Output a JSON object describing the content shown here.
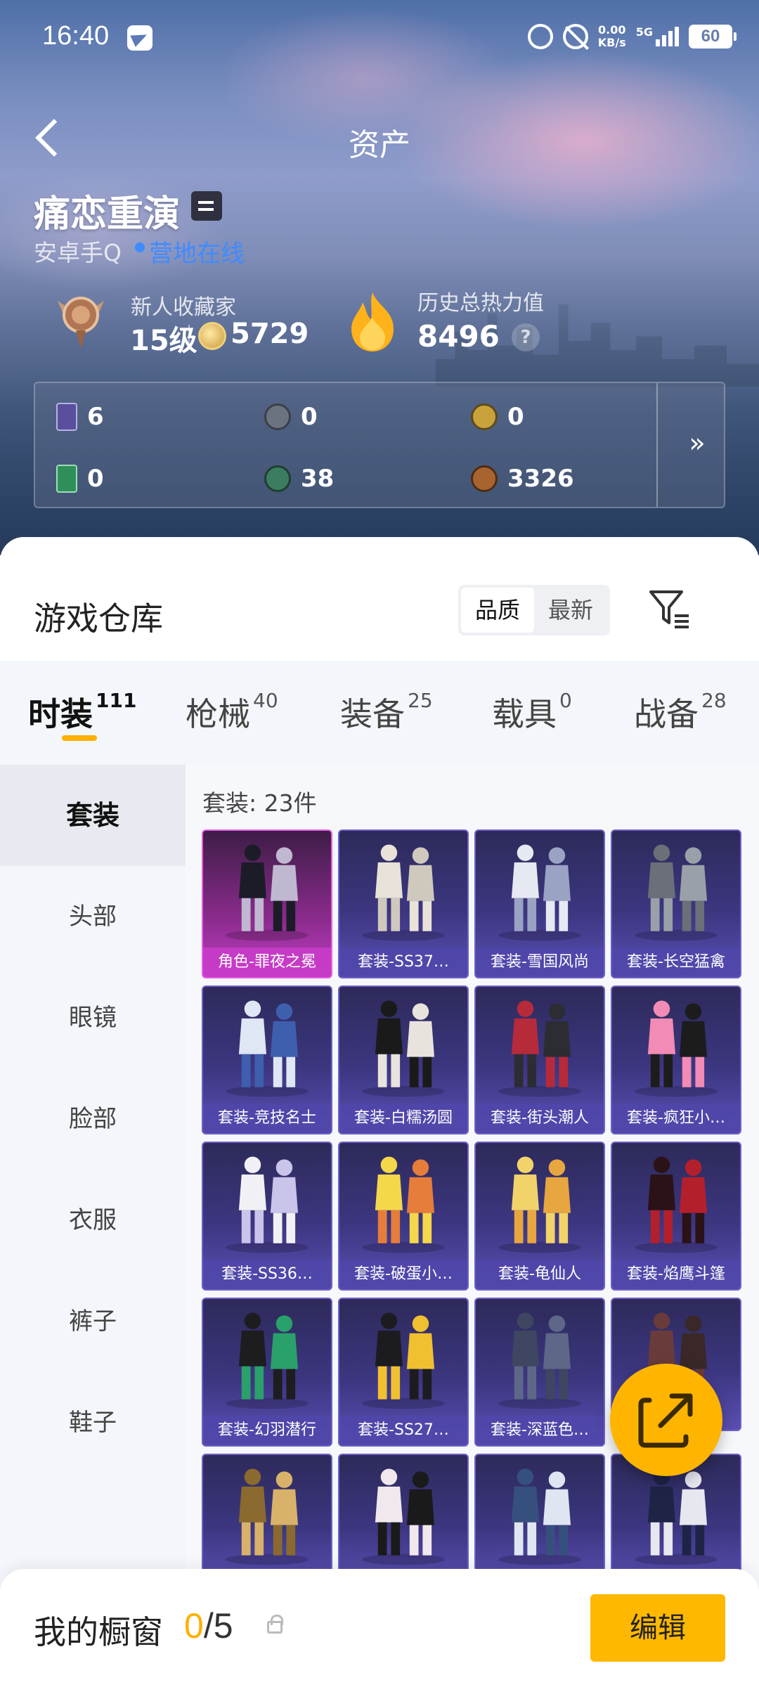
{
  "status_bar": {
    "time": "16:40",
    "network_speed_value": "0.00",
    "network_speed_unit": "KB/s",
    "network_type": "5G",
    "battery": "60"
  },
  "nav": {
    "title": "资产"
  },
  "profile": {
    "name": "痛恋重演",
    "platform": "安卓手Q",
    "online_status": "营地在线",
    "collector_title": "新人收藏家",
    "collector_level": "15级",
    "collector_points": "5729",
    "heat_title": "历史总热力值",
    "heat_value": "8496",
    "help_label": "?"
  },
  "currencies": [
    {
      "icon": "purple-card-icon",
      "value": "6",
      "color": "#5a4f9c"
    },
    {
      "icon": "silver-coin-icon",
      "value": "0",
      "color": "#6c7380"
    },
    {
      "icon": "gold-coin-icon",
      "value": "0",
      "color": "#c9a23b"
    },
    {
      "icon": "green-card-icon",
      "value": "0",
      "color": "#2f8f5a"
    },
    {
      "icon": "green-gem-icon",
      "value": "38",
      "color": "#3c7d62"
    },
    {
      "icon": "bronze-coin-icon",
      "value": "3326",
      "color": "#a8642f"
    }
  ],
  "currency_more_label": "»",
  "warehouse": {
    "title": "游戏仓库",
    "sort_options": [
      "品质",
      "最新"
    ],
    "sort_selected": "品质"
  },
  "tabs": [
    {
      "label": "时装",
      "count": "111",
      "active": true
    },
    {
      "label": "枪械",
      "count": "40",
      "active": false
    },
    {
      "label": "装备",
      "count": "25",
      "active": false
    },
    {
      "label": "载具",
      "count": "0",
      "active": false
    },
    {
      "label": "战备",
      "count": "28",
      "active": false
    }
  ],
  "sidebar": [
    "套装",
    "头部",
    "眼镜",
    "脸部",
    "衣服",
    "裤子",
    "鞋子"
  ],
  "count_label": "套装: 23件",
  "items": [
    {
      "name": "角色-罪夜之冕",
      "rarity": "pink"
    },
    {
      "name": "套装-SS37…",
      "rarity": "purple"
    },
    {
      "name": "套装-雪国风尚",
      "rarity": "purple"
    },
    {
      "name": "套装-长空猛禽",
      "rarity": "purple"
    },
    {
      "name": "套装-竞技名士",
      "rarity": "purple"
    },
    {
      "name": "套装-白糯汤圆",
      "rarity": "purple"
    },
    {
      "name": "套装-街头潮人",
      "rarity": "purple"
    },
    {
      "name": "套装-疯狂小…",
      "rarity": "purple"
    },
    {
      "name": "套装-SS36…",
      "rarity": "purple"
    },
    {
      "name": "套装-破蛋小…",
      "rarity": "purple"
    },
    {
      "name": "套装-龟仙人",
      "rarity": "purple"
    },
    {
      "name": "套装-焰鹰斗篷",
      "rarity": "purple"
    },
    {
      "name": "套装-幻羽潜行",
      "rarity": "purple"
    },
    {
      "name": "套装-SS27…",
      "rarity": "purple"
    },
    {
      "name": "套装-深蓝色…",
      "rarity": "purple"
    },
    {
      "name": "",
      "rarity": "purple"
    },
    {
      "name": "",
      "rarity": "purple"
    },
    {
      "name": "",
      "rarity": "purple"
    },
    {
      "name": "",
      "rarity": "purple"
    },
    {
      "name": "",
      "rarity": "purple"
    }
  ],
  "showcase": {
    "label": "我的橱窗",
    "current": "0",
    "separator": "/",
    "max": "5",
    "edit_label": "编辑"
  },
  "colors": {
    "accent": "#ffb000",
    "online": "#3f8bff",
    "card_purple": "#3c3680",
    "card_pink": "#c13ec4"
  }
}
